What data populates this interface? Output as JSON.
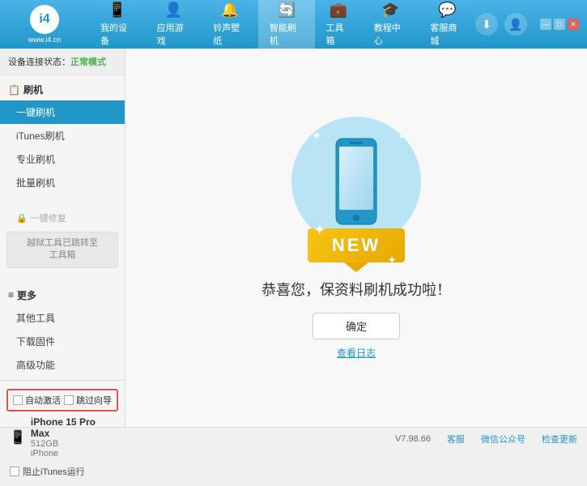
{
  "header": {
    "logo_icon": "i4",
    "logo_text": "www.i4.cn",
    "nav_items": [
      {
        "id": "my-device",
        "label": "我的设备",
        "icon": "📱"
      },
      {
        "id": "apps",
        "label": "应用游戏",
        "icon": "👤"
      },
      {
        "id": "ringtone",
        "label": "铃声壁纸",
        "icon": "🔔"
      },
      {
        "id": "smart-flash",
        "label": "智能刷机",
        "icon": "🔄"
      },
      {
        "id": "toolbox",
        "label": "工具箱",
        "icon": "💼"
      },
      {
        "id": "tutorial",
        "label": "教程中心",
        "icon": "🎓"
      },
      {
        "id": "service",
        "label": "客服商城",
        "icon": "💬"
      }
    ],
    "download_tooltip": "下载",
    "user_tooltip": "用户",
    "win_controls": {
      "minimize": "—",
      "maximize": "□",
      "close": "✕"
    }
  },
  "sidebar": {
    "status_label": "设备连接状态：",
    "status_text": "正常模式",
    "sections": [
      {
        "id": "flash",
        "header": "刷机",
        "items": [
          {
            "id": "one-click-flash",
            "label": "一键刷机",
            "active": true
          },
          {
            "id": "itunes-flash",
            "label": "iTunes刷机",
            "active": false
          },
          {
            "id": "pro-flash",
            "label": "专业刷机",
            "active": false
          },
          {
            "id": "batch-flash",
            "label": "批量刷机",
            "active": false
          }
        ]
      },
      {
        "id": "repair",
        "header": "一键修复",
        "disabled_text": "越狱工具已跳转至\n工具箱",
        "disabled": true
      },
      {
        "id": "more",
        "header": "更多",
        "items": [
          {
            "id": "other-tools",
            "label": "其他工具"
          },
          {
            "id": "download-firmware",
            "label": "下载固件"
          },
          {
            "id": "advanced",
            "label": "高级功能"
          }
        ]
      }
    ],
    "auto_activate_label": "自动激活",
    "guide_export_label": "跳过向导",
    "device": {
      "name": "iPhone 15 Pro Max",
      "storage": "512GB",
      "type": "iPhone"
    },
    "itunes_label": "阻止iTunes运行"
  },
  "content": {
    "success_title": "恭喜您，保资料刷机成功啦！",
    "confirm_button": "确定",
    "log_link": "查看日志",
    "new_badge": "NEW",
    "sparkles": [
      "✦",
      "✦"
    ]
  },
  "footer": {
    "version": "V7.98.66",
    "links": [
      "客服",
      "微信公众号",
      "检查更新"
    ]
  }
}
